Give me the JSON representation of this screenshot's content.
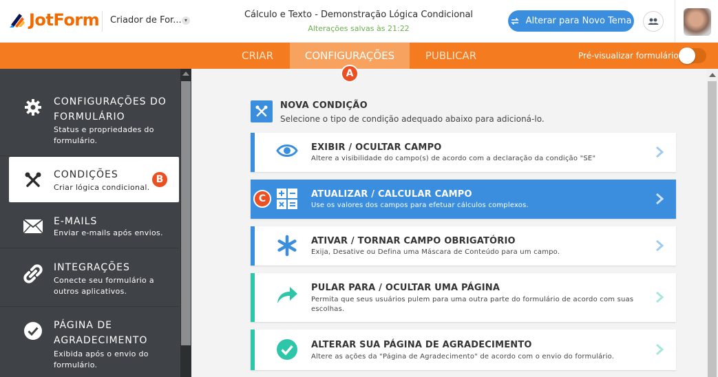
{
  "header": {
    "logo_text": "JotForm",
    "builder_label": "Criador de For...",
    "form_title": "Cálculo e Texto - Demonstração Lógica Condicional",
    "save_status": "Alterações salvas às 21:22",
    "theme_button": "Alterar para Novo Tema"
  },
  "nav": {
    "tabs": [
      {
        "label": "CRIAR",
        "active": false
      },
      {
        "label": "CONFIGURAÇÕES",
        "active": true
      },
      {
        "label": "PUBLICAR",
        "active": false
      }
    ],
    "preview_label": "Pré-visualizar formulário",
    "preview_enabled": false
  },
  "markers": {
    "a": "A",
    "b": "B",
    "c": "C"
  },
  "sidebar": {
    "items": [
      {
        "icon": "gear-icon",
        "title": "CONFIGURAÇÕES DO FORMULÁRIO",
        "desc": "Status e propriedades do formulário."
      },
      {
        "icon": "tools-icon",
        "title": "CONDIÇÕES",
        "desc": "Criar lógica condicional.",
        "active": true
      },
      {
        "icon": "envelope-icon",
        "title": "E-MAILS",
        "desc": "Enviar e-mails após envios."
      },
      {
        "icon": "link-icon",
        "title": "INTEGRAÇÕES",
        "desc": "Conecte seu formulário a outros aplicativos."
      },
      {
        "icon": "checkmark-icon",
        "title": "PÁGINA DE AGRADECIMENTO",
        "desc": "Exibida após o envio do formulário."
      }
    ]
  },
  "main": {
    "new_condition_title": "NOVA CONDIÇÃO",
    "new_condition_subtitle": "Selecione o tipo de condição adequado abaixo para adicioná-lo.",
    "cards": [
      {
        "icon": "eye-icon",
        "title": "EXIBIR / OCULTAR CAMPO",
        "desc": "Altere a visibilidade do campo(s) de acordo com a declaração da condição \"SE\""
      },
      {
        "icon": "calculator-icon",
        "title": "ATUALIZAR / CALCULAR CAMPO",
        "desc": "Use os valores dos campos para efetuar cálculos complexos.",
        "active": true
      },
      {
        "icon": "asterisk-icon",
        "title": "ATIVAR / TORNAR CAMPO OBRIGATÓRIO",
        "desc": "Exija, Desative ou Defina uma Máscara de Conteúdo para um campo."
      },
      {
        "icon": "share-arrow-icon",
        "title": "PULAR PARA / OCULTAR UMA PÁGINA",
        "desc": "Permita que seus usuários pulem para uma outra parte do formulário de acordo com suas escolhas."
      },
      {
        "icon": "check-circle-icon",
        "title": "ALTERAR SUA PÁGINA DE AGRADECIMENTO",
        "desc": "Altere as ações da \"Página de Agradecimento\" de acordo com o envio do formulário."
      }
    ]
  },
  "colors": {
    "brand_orange": "#f47b20",
    "accent_blue": "#3b8ede",
    "accent_teal": "#2dc6a8",
    "marker_red": "#ec4f22",
    "sidebar_bg": "#3f4347"
  }
}
